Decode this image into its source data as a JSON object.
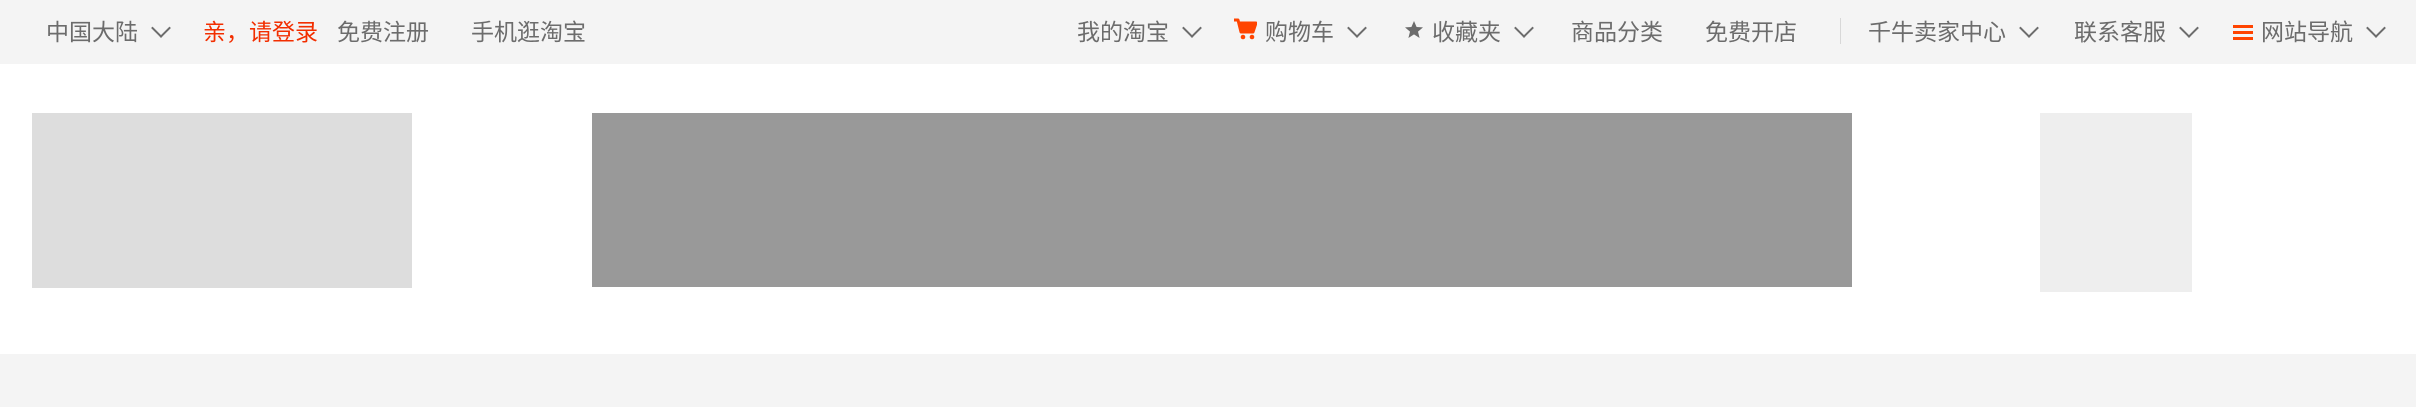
{
  "topbar": {
    "region_label": "中国大陆",
    "login_label": "亲，请登录",
    "register_label": "免费注册",
    "mobile_label": "手机逛淘宝",
    "my_taobao_label": "我的淘宝",
    "cart_label": "购物车",
    "favorites_label": "收藏夹",
    "categories_label": "商品分类",
    "open_shop_label": "免费开店",
    "seller_center_label": "千牛卖家中心",
    "customer_service_label": "联系客服",
    "site_nav_label": "网站导航"
  },
  "icons": {
    "chevron": "chevron-down-icon",
    "cart": "cart-icon",
    "star": "star-icon",
    "menu": "menu-icon"
  },
  "colors": {
    "accent": "#ff4400",
    "login_text": "#f22e00",
    "topbar_bg": "#f4f4f4",
    "text_gray": "#6c6c6c",
    "placeholder_logo": "#dddddd",
    "placeholder_search": "#999999",
    "placeholder_qr": "#eeeeee"
  }
}
